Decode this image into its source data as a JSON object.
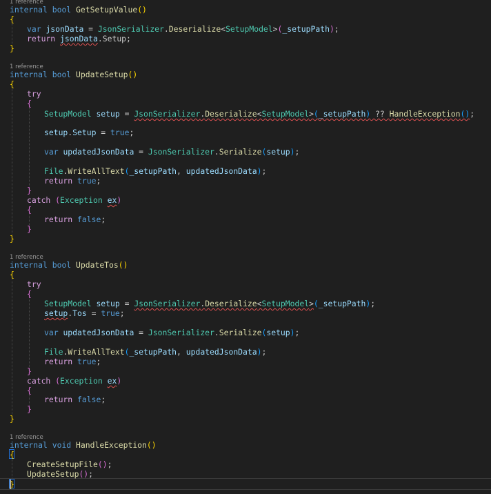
{
  "editor": {
    "codelens": "1 reference",
    "methods": [
      {
        "signature": {
          "access": "internal",
          "ret": "bool",
          "name": "GetSetupValue",
          "parens": "()"
        },
        "open_brace": "{",
        "var_kw": "var",
        "json_data": "jsonData",
        "eq": " = ",
        "serializer": "JsonSerializer",
        "dot": ".",
        "deserialize": "Deserialize",
        "lt": "<",
        "model": "SetupModel",
        "gt": ">",
        "setup_path_call": "(_setupPath);",
        "return_kw": "return",
        "return_expr_obj": "jsonData",
        "return_expr_prop": ".Setup;",
        "close_brace": "}"
      },
      {
        "signature": {
          "access": "internal",
          "ret": "bool",
          "name": "UpdateSetup",
          "parens": "()"
        },
        "try_kw": "try",
        "catch_kw": "catch",
        "exception_type": "Exception",
        "exception_var": "ex",
        "setup_decl_type": "SetupModel",
        "setup_decl_var": "setup",
        "setup_arg": "_setupPath",
        "null_coalesce": " ?? ",
        "handle_call": "HandleException",
        "assign_obj": "setup",
        "assign_prop": "Setup",
        "assign_val": "true",
        "updated_var": "updatedJsonData",
        "serialize": "Serialize",
        "file_cls": "File",
        "write_all": "WriteAllText",
        "true_val": "true",
        "false_val": "false"
      },
      {
        "signature": {
          "access": "internal",
          "ret": "bool",
          "name": "UpdateTos",
          "parens": "()"
        },
        "assign_prop": "Tos"
      },
      {
        "signature": {
          "access": "internal",
          "ret": "void",
          "name": "HandleException",
          "parens": "()"
        },
        "call1": "CreateSetupFile",
        "call2": "UpdateSetup"
      }
    ]
  }
}
